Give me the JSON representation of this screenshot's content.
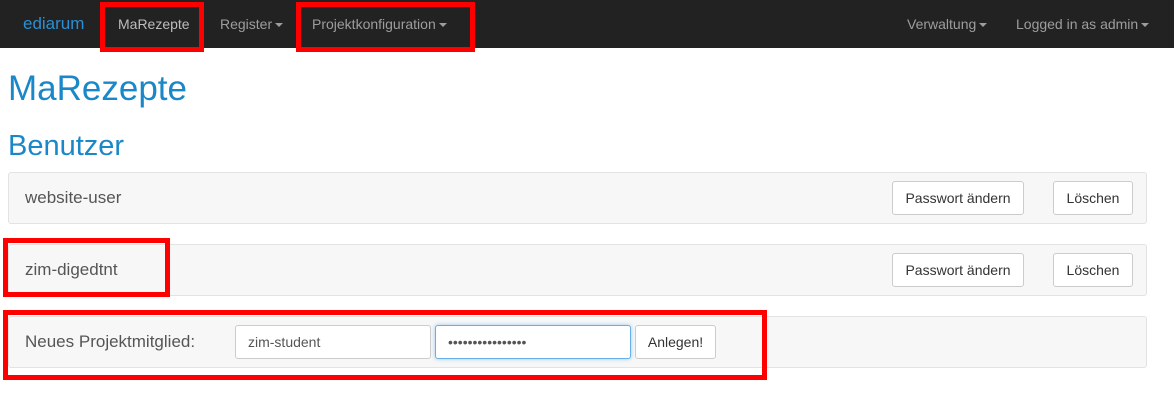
{
  "navbar": {
    "brand": "ediarum",
    "items": [
      {
        "label": "MaRezepte"
      },
      {
        "label": "Register"
      },
      {
        "label": "Projektkonfiguration"
      }
    ],
    "right_items": [
      {
        "label": "Verwaltung"
      },
      {
        "label": "Logged in as admin"
      }
    ]
  },
  "page": {
    "title": "MaRezepte",
    "section_title": "Benutzer"
  },
  "users": [
    {
      "name": "website-user",
      "change_password_label": "Passwort ändern",
      "delete_label": "Löschen"
    },
    {
      "name": "zim-digedtnt",
      "change_password_label": "Passwort ändern",
      "delete_label": "Löschen"
    }
  ],
  "new_member": {
    "label": "Neues Projektmitglied:",
    "username_value": "zim-student",
    "password_value": "••••••••••••••••",
    "submit_label": "Anlegen!"
  },
  "colors": {
    "navbar_bg": "#222222",
    "brand": "#2a8fd4",
    "heading": "#1a87c9",
    "annotation": "#ff0000"
  }
}
